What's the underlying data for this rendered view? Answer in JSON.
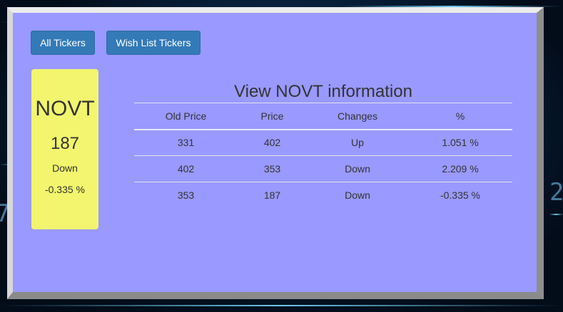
{
  "buttons": {
    "all_tickers": "All Tickers",
    "wish_list": "Wish List Tickers"
  },
  "ticker_card": {
    "symbol": "NOVT",
    "price": "187",
    "direction": "Down",
    "percent": "-0.335 %"
  },
  "info": {
    "heading": "View NOVT information",
    "columns": [
      "Old Price",
      "Price",
      "Changes",
      "%"
    ],
    "rows": [
      [
        "331",
        "402",
        "Up",
        "1.051 %"
      ],
      [
        "402",
        "353",
        "Down",
        "2.209 %"
      ],
      [
        "353",
        "187",
        "Down",
        "-0.335 %"
      ]
    ]
  },
  "colors": {
    "panel_bg": "#9999ff",
    "card_bg": "#f2f56d",
    "button_bg": "#337ab7"
  }
}
